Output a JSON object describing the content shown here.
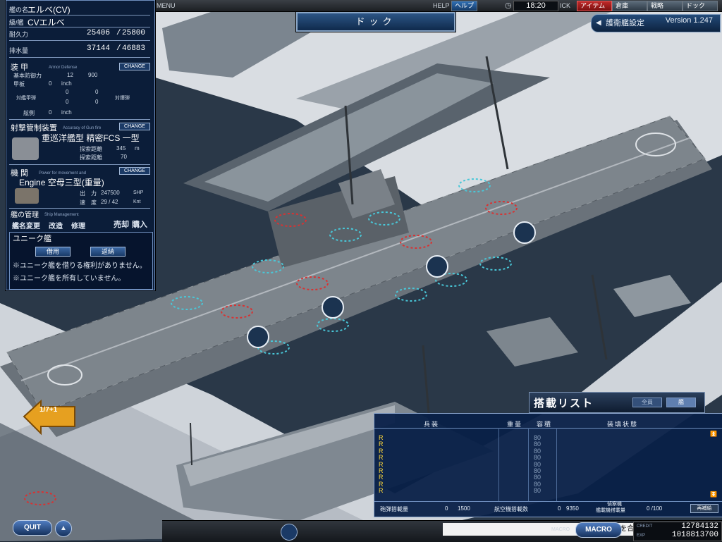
{
  "topbar": {
    "menu": "MENU",
    "help": "HELP",
    "help_btn": "ヘルプ",
    "time": "18:20",
    "tick": "ICK",
    "tabs": [
      "アイテム",
      "倉庫",
      "戦略",
      "ドック"
    ]
  },
  "dock_title": "ドック",
  "escort": {
    "label": "護衛艦設定",
    "version": "Version 1.247"
  },
  "ship": {
    "name_label": "艦の名",
    "name": "エルベ(CV)",
    "class_label": "級/艦",
    "class": "CVエルベ",
    "durability_label": "耐久力",
    "durability": "25406",
    "durability_max": "25800",
    "displacement_label": "排水量",
    "displacement": "37144",
    "displacement_max": "46883"
  },
  "armor": {
    "title": "装 甲",
    "subtitle": "Armor Defense",
    "change": "CHANGE",
    "base_label": "基本防御力",
    "base_1": "12",
    "base_2": "900",
    "deck_label": "甲板",
    "deck_val": "0",
    "deck_unit": "inch",
    "vs_main_label": "対艦甲弾",
    "vs_main_1": "0",
    "vs_main_2": "0",
    "vs_main_3": "0",
    "vs_main_4": "0",
    "vs_torp_label": "対爆弾",
    "side_label": "舷側",
    "side_val": "0",
    "side_unit": "inch"
  },
  "fcs": {
    "title": "射撃管制装置",
    "subtitle": "Accuracy of Gun fire",
    "change": "CHANGE",
    "name": "重巡洋艦型 精密FCS 一型",
    "range_label": "探索距離",
    "range_val": "345",
    "range_unit": "m",
    "range2_label": "探索距離",
    "range2_val": "70"
  },
  "engine": {
    "title": "機 関",
    "subtitle": "Power for movement and",
    "change": "CHANGE",
    "name": "Engine 空母三型(重量)",
    "power_label": "出　力",
    "power_val": "247500",
    "power_unit": "SHP",
    "speed_label": "速　度",
    "speed_val": "29 / 42",
    "speed_unit": "Knt"
  },
  "management": {
    "title": "艦の管理",
    "subtitle": "Ship Management",
    "rename": "艦名変更",
    "refit": "改造",
    "repair": "修理",
    "sell": "売却",
    "buy": "購入"
  },
  "unique": {
    "title": "ユニーク艦",
    "borrow": "借用",
    "return": "返納",
    "msg1": "※ユニーク艦を借りる権利がありません。",
    "msg2": "※ユニーク艦を所有していません。"
  },
  "page_indicator": "1/7+1",
  "carrier_list": {
    "title": "搭載リスト",
    "tab1": "全員",
    "tab2": "艦",
    "headers": [
      "兵装",
      "重量",
      "容積",
      "装填状態"
    ],
    "rows": [
      {
        "weapon": "R",
        "capacity": "80"
      },
      {
        "weapon": "R",
        "capacity": "80"
      },
      {
        "weapon": "R",
        "capacity": "80"
      },
      {
        "weapon": "R",
        "capacity": "80"
      },
      {
        "weapon": "R",
        "capacity": "80"
      },
      {
        "weapon": "R",
        "capacity": "80"
      },
      {
        "weapon": "R",
        "capacity": "80"
      },
      {
        "weapon": "R",
        "capacity": "80"
      },
      {
        "weapon": "R",
        "capacity": "80"
      }
    ],
    "footer": {
      "shell_label": "砲弾搭載量",
      "shell_val": "0",
      "shell_max": "1500",
      "aircraft_label": "航空機搭載数",
      "aircraft_val": "0",
      "aircraft_max": "9350",
      "recon_label": "偵察機",
      "recon_sub": "艦載機搭載量",
      "recon_val": "0 /100",
      "reset": "再補給"
    }
  },
  "bottom": {
    "quit": "QUIT",
    "help_text": "マウスを合わせた際にヘルプ:",
    "macro_small": "MACRO",
    "macro": "MACRO",
    "credit_label": "CREDIT",
    "credit_val": "12784132",
    "exp_label": "EXP",
    "exp_val": "1018813700"
  }
}
